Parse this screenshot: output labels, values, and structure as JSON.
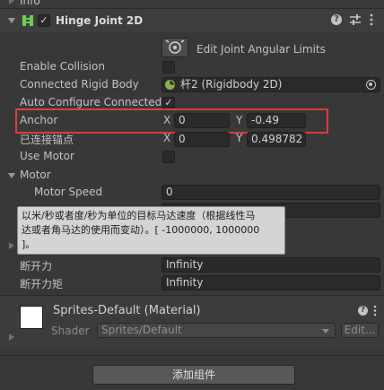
{
  "top": {
    "info_label": "Info"
  },
  "component": {
    "title": "Hinge Joint 2D",
    "help_icon": "help-icon",
    "settings_icon": "sliders-icon",
    "menu_icon": "kebab-menu-icon"
  },
  "edit_limits": {
    "label": "Edit Joint Angular Limits"
  },
  "fields": {
    "enable_collision": "Enable Collision",
    "connected_body": "Connected Rigid Body",
    "connected_body_value": "杆2 (Rigidbody 2D)",
    "auto_configure": "Auto Configure Connected",
    "anchor": "Anchor",
    "anchor_x_label": "X",
    "anchor_x": "0",
    "anchor_y_label": "Y",
    "anchor_y": "-0.49",
    "connected_anchor": "已连接锚点",
    "connected_anchor_x_label": "X",
    "connected_anchor_x": "0",
    "connected_anchor_y_label": "Y",
    "connected_anchor_y": "0.498782",
    "use_motor": "Use Motor",
    "motor": "Motor",
    "motor_speed": "Motor Speed",
    "motor_speed_value": "0",
    "tooltip_line1": "以米/秒或者度/秒为单位的目标马达速度（根据线性马",
    "tooltip_line2": "达或者角马达的使用而变动）。[ -1000000, 1000000",
    "tooltip_line3": "]。",
    "break_force": "断开力",
    "break_force_value": "Infinity",
    "break_torque": "断开力矩",
    "break_torque_value": "Infinity"
  },
  "material": {
    "title": "Sprites-Default (Material)",
    "shader_label": "Shader",
    "shader_value": "Sprites/Default",
    "edit_button": "Edit..."
  },
  "footer": {
    "add_component": "添加组件"
  },
  "colors": {
    "highlight_border": "#e23b3b",
    "background": "#383838",
    "field": "#2a2a2a"
  }
}
